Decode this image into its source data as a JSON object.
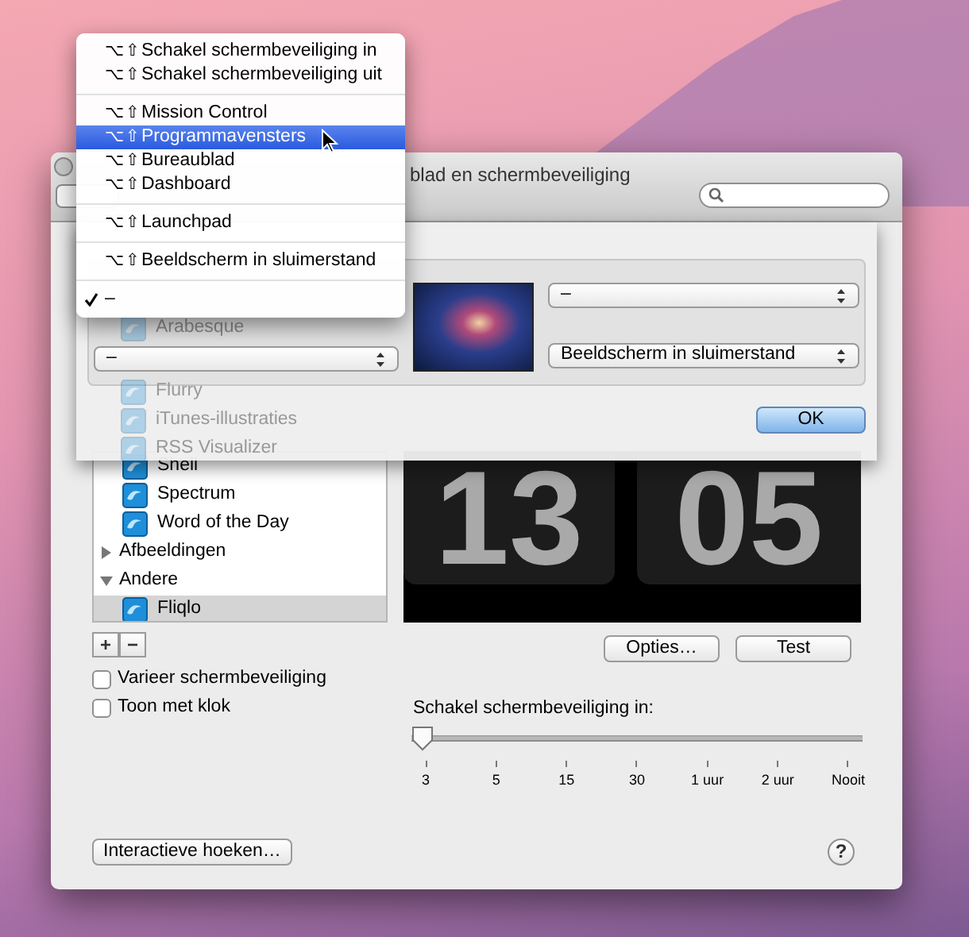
{
  "window": {
    "title": "blad en schermbeveiliging"
  },
  "menu": {
    "groups": [
      {
        "items": [
          {
            "shortcut": "⌥⇧",
            "label": "Schakel schermbeveiliging in",
            "selected": false,
            "checked": false
          },
          {
            "shortcut": "⌥⇧",
            "label": "Schakel schermbeveiliging uit",
            "selected": false,
            "checked": false
          }
        ]
      },
      {
        "items": [
          {
            "shortcut": "⌥⇧",
            "label": "Mission Control",
            "selected": false,
            "checked": false
          },
          {
            "shortcut": "⌥⇧",
            "label": "Programmavensters",
            "selected": true,
            "checked": false
          },
          {
            "shortcut": "⌥⇧",
            "label": "Bureaublad",
            "selected": false,
            "checked": false
          },
          {
            "shortcut": "⌥⇧",
            "label": "Dashboard",
            "selected": false,
            "checked": false
          }
        ]
      },
      {
        "items": [
          {
            "shortcut": "⌥⇧",
            "label": "Launchpad",
            "selected": false,
            "checked": false
          }
        ]
      },
      {
        "items": [
          {
            "shortcut": "⌥⇧",
            "label": "Beeldscherm in sluimerstand",
            "selected": false,
            "checked": false
          }
        ]
      },
      {
        "items": [
          {
            "label": "–",
            "selected": false,
            "checked": true
          }
        ]
      }
    ]
  },
  "sheet": {
    "background_items": [
      "Arabesque",
      "Flurry",
      "iTunes-illustraties",
      "RSS Visualizer"
    ],
    "corners": {
      "top_right": "–",
      "bottom_left": "–",
      "bottom_right": "Beeldscherm in sluimerstand"
    },
    "ok_button": "OK"
  },
  "list": [
    {
      "kind": "screensaver",
      "label": "Shell",
      "selected": false
    },
    {
      "kind": "screensaver",
      "label": "Spectrum",
      "selected": false
    },
    {
      "kind": "screensaver",
      "label": "Word of the Day",
      "selected": false
    },
    {
      "kind": "group",
      "label": "Afbeeldingen",
      "expanded": false
    },
    {
      "kind": "group",
      "label": "Andere",
      "expanded": true,
      "children": [
        {
          "kind": "screensaver",
          "label": "Fliqlo",
          "selected": true
        }
      ]
    }
  ],
  "list_buttons": [
    "+",
    "−"
  ],
  "preview": {
    "hours": "13",
    "minutes": "05"
  },
  "preview_buttons": [
    "Opties…",
    "Test"
  ],
  "checkboxes": [
    {
      "label": "Varieer schermbeveiliging",
      "checked": false
    },
    {
      "label": "Toon met klok",
      "checked": false
    }
  ],
  "slider": {
    "label": "Schakel schermbeveiliging in:",
    "level": 0,
    "ticks": [
      "3",
      "5",
      "15",
      "30",
      "1 uur",
      "2 uur",
      "Nooit"
    ]
  },
  "hot_corners_button": "Interactieve hoeken…",
  "help_button": "?"
}
